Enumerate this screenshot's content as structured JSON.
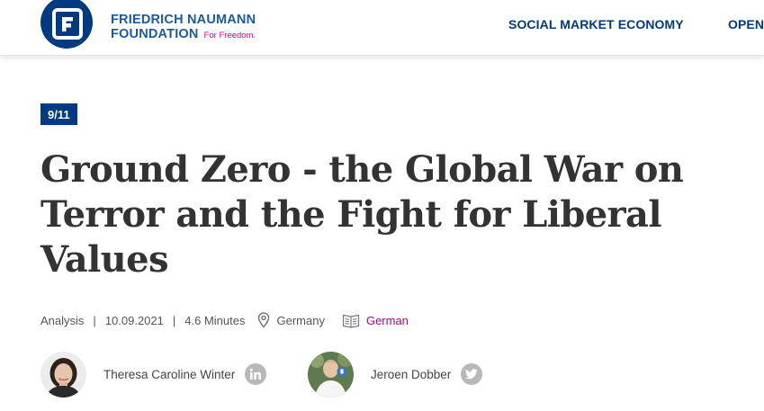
{
  "header": {
    "logo_line1": "FRIEDRICH NAUMANN",
    "logo_line2": "FOUNDATION",
    "logo_tagline": "For Freedom.",
    "nav": [
      {
        "label": "SOCIAL MARKET ECONOMY"
      },
      {
        "label": "OPEN"
      }
    ]
  },
  "article": {
    "tag": "9/11",
    "title": "Ground Zero - the Global War on Terror and the Fight for Liberal Values",
    "meta": {
      "type": "Analysis",
      "separator": "|",
      "date": "10.09.2021",
      "read_time": "4.6 Minutes",
      "location": "Germany",
      "language": "German"
    },
    "authors": [
      {
        "name": "Theresa Caroline Winter",
        "social_icon": "linkedin-icon"
      },
      {
        "name": "Jeroen Dobber",
        "social_icon": "twitter-icon"
      }
    ]
  },
  "colors": {
    "brand_blue": "#003a80",
    "logo_text_blue": "#1b5aa5",
    "accent_magenta": "#c0007a",
    "icon_gray": "#b8b8b8"
  }
}
